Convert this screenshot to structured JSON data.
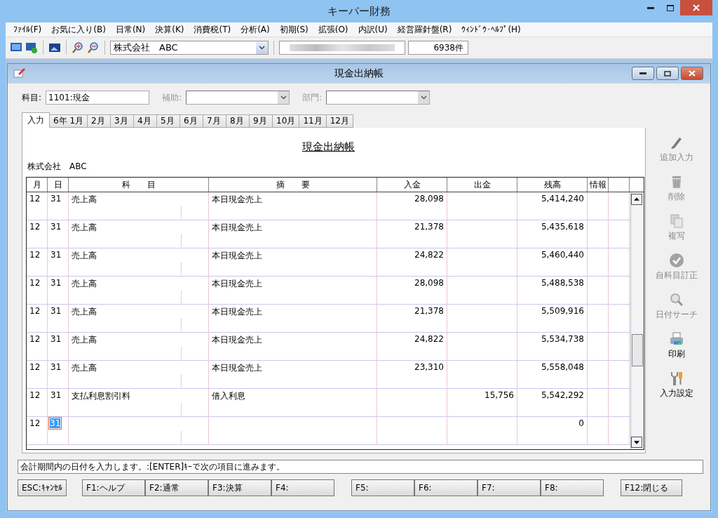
{
  "app_window": {
    "title": "キーパー財務"
  },
  "menu": [
    "ﾌｧｲﾙ(F)",
    "お気に入り(B)",
    "日常(N)",
    "決算(K)",
    "消費税(T)",
    "分析(A)",
    "初期(S)",
    "拡張(O)",
    "内訳(U)",
    "経営羅針盤(R)",
    "ｳｨﾝﾄﾞｳ･ﾍﾙﾌﾟ(H)"
  ],
  "toolbar": {
    "company": "株式会社　ABC",
    "record_count": "6938件"
  },
  "window": {
    "title": "現金出納帳"
  },
  "filters": [
    {
      "label": "科目:",
      "value": "1101:現金",
      "disabled": false,
      "kind": "text"
    },
    {
      "label": "補助:",
      "disabled": true,
      "kind": "select"
    },
    {
      "label": "部門:",
      "disabled": true,
      "kind": "select"
    }
  ],
  "tabs": [
    {
      "label": "入力",
      "selected": true
    },
    {
      "label": "6年 1月",
      "selected": false
    },
    {
      "label": "2月",
      "selected": false
    },
    {
      "label": "3月",
      "selected": false
    },
    {
      "label": "4月",
      "selected": false
    },
    {
      "label": "5月",
      "selected": false
    },
    {
      "label": "6月",
      "selected": false
    },
    {
      "label": "7月",
      "selected": false
    },
    {
      "label": "8月",
      "selected": false
    },
    {
      "label": "9月",
      "selected": false
    },
    {
      "label": "10月",
      "selected": false
    },
    {
      "label": "11月",
      "selected": false
    },
    {
      "label": "12月",
      "selected": false
    }
  ],
  "ledger": {
    "heading": "現金出納帳",
    "company": "株式会社　ABC",
    "columns": [
      "月",
      "日",
      "科　　目",
      "摘　　要",
      "入金",
      "出金",
      "残高",
      "情報"
    ],
    "rows": [
      {
        "month": "12",
        "day": "31",
        "account": "売上高",
        "description": "本日現金売上",
        "deposit": "28,098",
        "balance": "5,414,240",
        "editing": false
      },
      {
        "month": "12",
        "day": "31",
        "account": "売上高",
        "description": "本日現金売上",
        "deposit": "21,378",
        "balance": "5,435,618",
        "editing": false
      },
      {
        "month": "12",
        "day": "31",
        "account": "売上高",
        "description": "本日現金売上",
        "deposit": "24,822",
        "balance": "5,460,440",
        "editing": false
      },
      {
        "month": "12",
        "day": "31",
        "account": "売上高",
        "description": "本日現金売上",
        "deposit": "28,098",
        "balance": "5,488,538",
        "editing": false
      },
      {
        "month": "12",
        "day": "31",
        "account": "売上高",
        "description": "本日現金売上",
        "deposit": "21,378",
        "balance": "5,509,916",
        "editing": false
      },
      {
        "month": "12",
        "day": "31",
        "account": "売上高",
        "description": "本日現金売上",
        "deposit": "24,822",
        "balance": "5,534,738",
        "editing": false
      },
      {
        "month": "12",
        "day": "31",
        "account": "売上高",
        "description": "本日現金売上",
        "deposit": "23,310",
        "balance": "5,558,048",
        "editing": false
      },
      {
        "month": "12",
        "day": "31",
        "account": "支払利息割引料",
        "description": "借入利息",
        "withdrawal": "15,756",
        "balance": "5,542,292",
        "editing": false
      },
      {
        "month": "12",
        "day": "31",
        "balance": "0",
        "editing": true
      }
    ]
  },
  "side_actions": [
    {
      "label": "追加入力",
      "kind": "pen",
      "disabled": true
    },
    {
      "label": "削除",
      "kind": "trash",
      "disabled": true
    },
    {
      "label": "複写",
      "kind": "copy",
      "disabled": true
    },
    {
      "label": "自科目訂正",
      "kind": "check",
      "disabled": true
    },
    {
      "label": "日付サーチ",
      "kind": "search",
      "disabled": true
    },
    {
      "label": "印刷",
      "kind": "printer",
      "disabled": false
    },
    {
      "label": "入力設定",
      "kind": "tools",
      "disabled": false
    }
  ],
  "status_message": "会計期間内の日付を入力します。:[ENTER]ｷｰで次の項目に進みます。",
  "function_keys": [
    "ESC:ｷｬﾝｾﾙ",
    "F1:ヘルプ",
    "F2:通常",
    "F3:決算",
    "F4:",
    "F5:",
    "F6:",
    "F7:",
    "F8:",
    "F12:閉じる"
  ]
}
